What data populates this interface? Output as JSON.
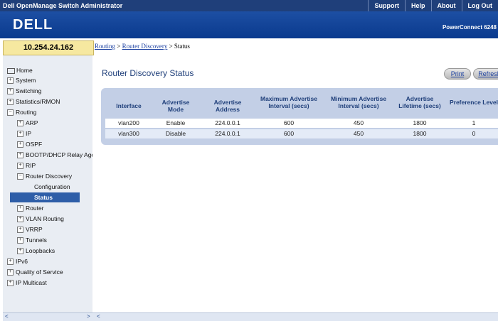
{
  "topbar": {
    "app_title": "Dell OpenManage Switch Administrator",
    "links": [
      "Support",
      "Help",
      "About",
      "Log Out"
    ]
  },
  "brand": {
    "logo": "DELL",
    "model": "PowerConnect 6248"
  },
  "ip_address": "10.254.24.162",
  "breadcrumb": {
    "crumb1": "Routing",
    "sep1": ">",
    "crumb2": "Router Discovery",
    "sep2": ">",
    "current": "Status"
  },
  "sidebar": {
    "items": [
      {
        "label": "Home"
      },
      {
        "label": "System"
      },
      {
        "label": "Switching"
      },
      {
        "label": "Statistics/RMON"
      },
      {
        "label": "Routing"
      },
      {
        "label": "ARP"
      },
      {
        "label": "IP"
      },
      {
        "label": "OSPF"
      },
      {
        "label": "BOOTP/DHCP Relay Agent"
      },
      {
        "label": "RIP"
      },
      {
        "label": "Router Discovery"
      },
      {
        "label": "Configuration"
      },
      {
        "label": "Status"
      },
      {
        "label": "Router"
      },
      {
        "label": "VLAN Routing"
      },
      {
        "label": "VRRP"
      },
      {
        "label": "Tunnels"
      },
      {
        "label": "Loopbacks"
      },
      {
        "label": "IPv6"
      },
      {
        "label": "Quality of Service"
      },
      {
        "label": "IP Multicast"
      }
    ]
  },
  "main": {
    "title": "Router Discovery Status",
    "print_label": "Print",
    "refresh_label": "Refresh"
  },
  "table": {
    "headers": [
      "Interface",
      "Advertise Mode",
      "Advertise Address",
      "Maximum Advertise Interval (secs)",
      "Minimum Advertise Interval (secs)",
      "Advertise Lifetime (secs)",
      "Preference Level"
    ],
    "rows": [
      [
        "vlan200",
        "Enable",
        "224.0.0.1",
        "600",
        "450",
        "1800",
        "1"
      ],
      [
        "vlan300",
        "Disable",
        "224.0.0.1",
        "600",
        "450",
        "1800",
        "0"
      ]
    ]
  },
  "colors": {
    "header_bar": "#1f3f7a",
    "brand_blue": "#0a3a8e",
    "selected": "#2e5ea8",
    "table_bg": "#c3cfe6"
  }
}
